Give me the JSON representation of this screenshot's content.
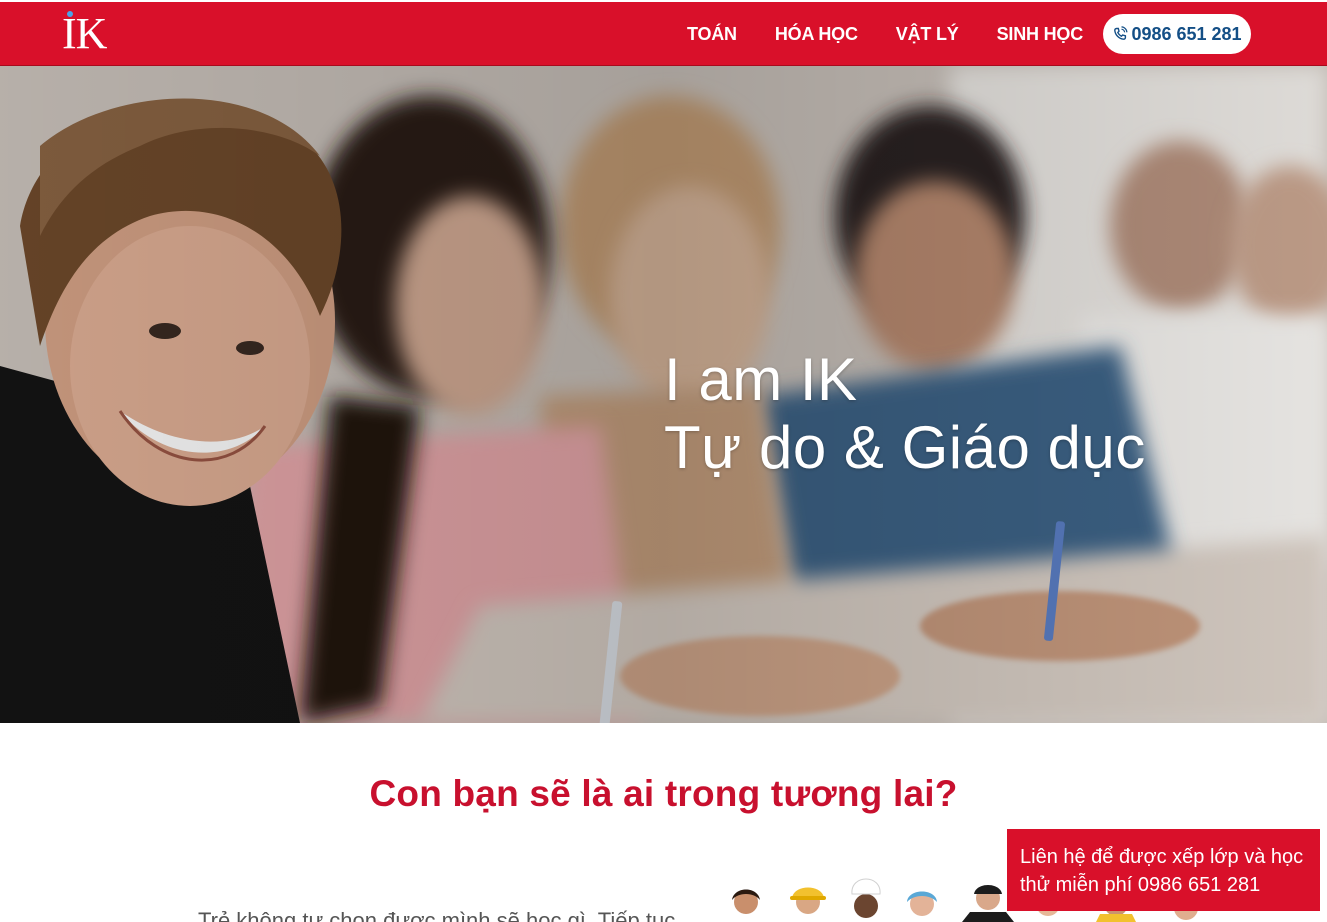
{
  "header": {
    "logo_text": "IK",
    "nav": [
      {
        "label": "TOÁN"
      },
      {
        "label": "HÓA HỌC"
      },
      {
        "label": "VẬT LÝ"
      },
      {
        "label": "SINH HỌC"
      }
    ],
    "phone": "0986 651 281"
  },
  "hero": {
    "line1": "I am IK",
    "line2": "Tự do & Giáo dục"
  },
  "intro": {
    "title": "Con bạn sẽ là ai trong tương lai?",
    "cutoff_text": "Trẻ không tự chọn được mình sẽ học gì. Tiếp tục"
  },
  "cta": {
    "text": "Liên hệ để được xếp lớp và học thử miễn phí 0986 651 281"
  },
  "colors": {
    "brand_red": "#d9102a",
    "title_red": "#c8102e",
    "phone_blue": "#144f86"
  },
  "icons": {
    "phone": "phone-icon"
  }
}
